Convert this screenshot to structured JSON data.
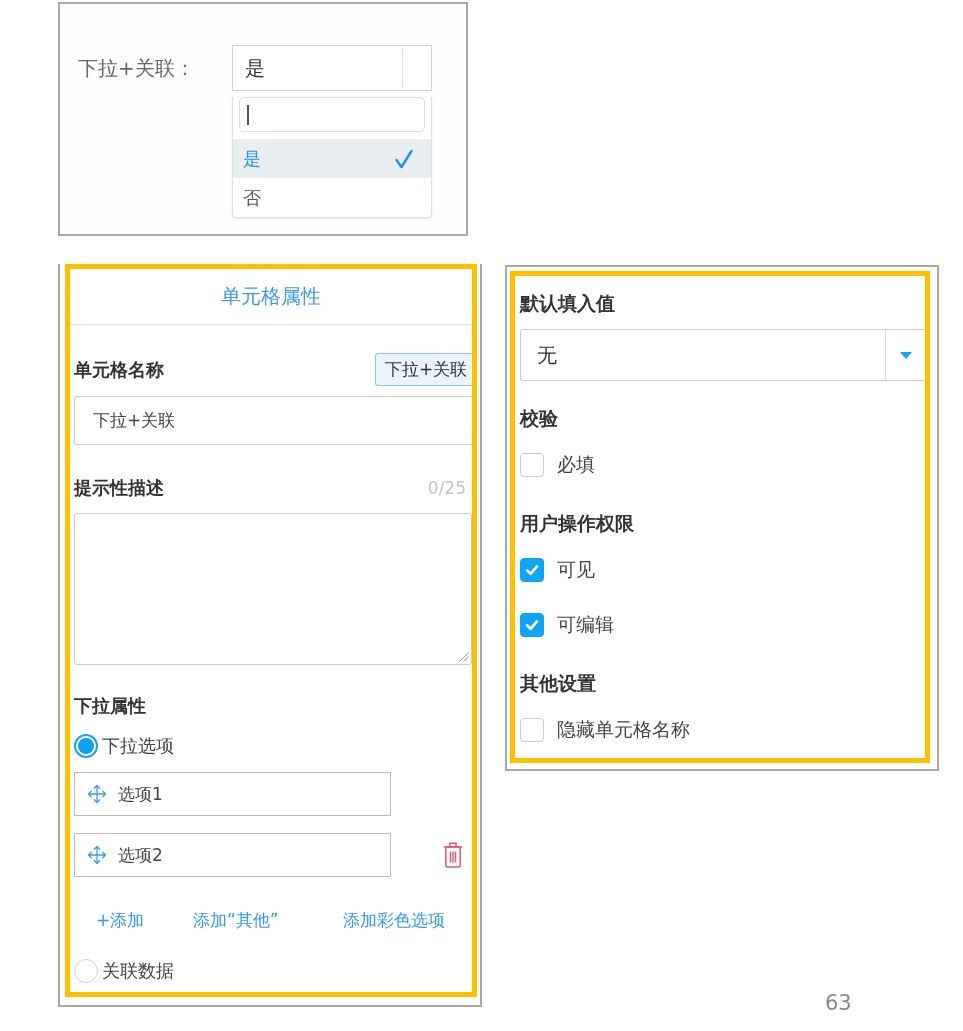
{
  "dropdown_preview": {
    "label": "下拉+关联：",
    "value": "是",
    "search_field": {
      "focused": true
    },
    "options": [
      {
        "label": "是",
        "selected": true
      },
      {
        "label": "否",
        "selected": false
      }
    ]
  },
  "cell_properties": {
    "title": "单元格属性",
    "name_field": {
      "label": "单元格名称",
      "tag": "下拉+关联",
      "value": "下拉+关联"
    },
    "description_field": {
      "label": "提示性描述",
      "counter": "0/25"
    },
    "dropdown_attributes": {
      "label": "下拉属性",
      "sources": [
        {
          "label": "下拉选项",
          "selected": true,
          "options": [
            {
              "value": "选项1",
              "deletable": false
            },
            {
              "value": "选项2",
              "deletable": true
            }
          ],
          "actions": [
            "+添加",
            "添加“其他”",
            "添加彩色选项"
          ]
        },
        {
          "label": "关联数据",
          "selected": false
        }
      ]
    }
  },
  "settings": {
    "default_value": {
      "label": "默认填入值",
      "value": "无"
    },
    "sections": [
      {
        "title": "校验",
        "items": [
          {
            "label": "必填",
            "checked": false
          }
        ]
      },
      {
        "title": "用户操作权限",
        "items": [
          {
            "label": "可见",
            "checked": true
          },
          {
            "label": "可编辑",
            "checked": true
          }
        ]
      },
      {
        "title": "其他设置",
        "items": [
          {
            "label": "隐藏单元格名称",
            "checked": false
          }
        ]
      }
    ]
  },
  "page_number": "63"
}
